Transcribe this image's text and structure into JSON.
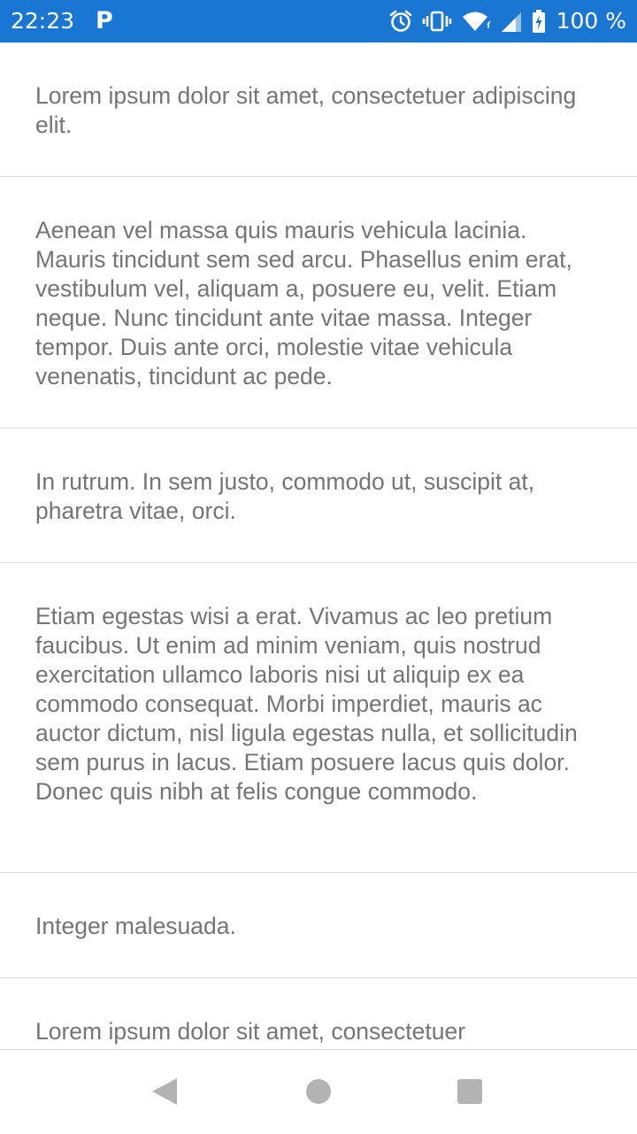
{
  "status_bar": {
    "time": "22:23",
    "notification_badge": "P",
    "battery_percent": "100 %",
    "background_color": "#1976d2",
    "icons": [
      "alarm-icon",
      "vibrate-icon",
      "wifi-icon",
      "signal-icon",
      "battery-icon"
    ]
  },
  "list": {
    "items": [
      {
        "text": "Lorem ipsum dolor sit amet, consectetuer adipiscing elit."
      },
      {
        "text": "Aenean vel massa quis mauris vehicula lacinia. Mauris tincidunt sem sed arcu. Phasellus enim erat, vestibulum vel, aliquam a, posuere eu, velit. Etiam neque. Nunc tincidunt ante vitae massa. Integer tempor. Duis ante orci, molestie vitae vehicula venenatis, tincidunt ac pede."
      },
      {
        "text": "In rutrum. In sem justo, commodo ut, suscipit at, pharetra vitae, orci."
      },
      {
        "text": "Etiam egestas wisi a erat. Vivamus ac leo pretium faucibus. Ut enim ad minim veniam, quis nostrud exercitation ullamco laboris nisi ut aliquip ex ea commodo consequat. Morbi imperdiet, mauris ac auctor dictum, nisl ligula egestas nulla, et sollicitudin sem purus in lacus. Etiam posuere lacus quis dolor. Donec quis nibh at felis congue commodo."
      },
      {
        "text": "Integer malesuada."
      },
      {
        "text": "Lorem ipsum dolor sit amet, consectetuer"
      }
    ]
  },
  "nav_bar": {
    "icons": [
      "back-icon",
      "home-icon",
      "recents-icon"
    ]
  }
}
